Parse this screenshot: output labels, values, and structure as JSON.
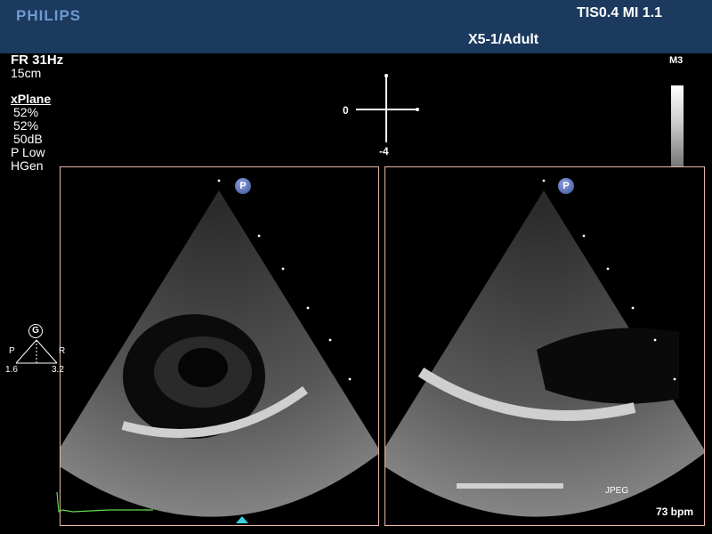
{
  "header": {
    "brand": "PHILIPS",
    "tis_mi": "TIS0.4   MI 1.1",
    "probe_preset": "X5-1/Adult"
  },
  "params": {
    "frame_rate": "FR 31Hz",
    "depth": "15cm",
    "mode": "xPlane",
    "gain1": "52%",
    "gain2": "52%",
    "dynamic_range": "50dB",
    "power": "P Low",
    "harmonic": "HGen"
  },
  "map": {
    "label": "M3"
  },
  "orientation": {
    "label_0": "0",
    "label_neg4": "-4"
  },
  "panels": {
    "left_marker": "P",
    "right_marker": "P"
  },
  "angle_widget": {
    "g": "G",
    "p": "P",
    "r": "R",
    "val_left": "1.6",
    "val_right": "3.2"
  },
  "footer": {
    "compression": "JPEG",
    "heart_rate": "73 bpm"
  },
  "colors": {
    "header_bg": "#1b3a5e",
    "brand": "#6f9ad1",
    "panel_border": "#e8b9a8",
    "ecg": "#5fdc4a",
    "focus_marker": "#3ad0e0"
  }
}
